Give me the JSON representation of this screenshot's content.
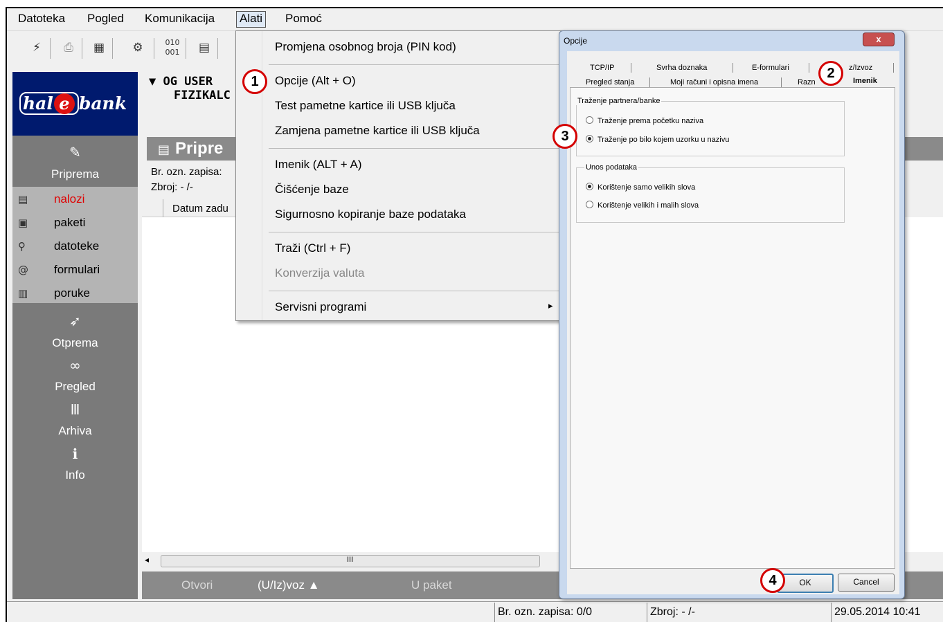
{
  "menubar": [
    "Datoteka",
    "Pogled",
    "Komunikacija",
    "Alati",
    "Pomoć"
  ],
  "toolbar_icons": [
    "connect-icon",
    "print-icon",
    "book-icon",
    "settings-icon",
    "binary-icon",
    "document-icon"
  ],
  "sidebar": {
    "logo": {
      "hal": "hal",
      "e": "e",
      "bank": "bank"
    },
    "sections": [
      {
        "icon": "edit-icon",
        "label": "Priprema"
      },
      {
        "icon": "send-icon",
        "label": "Otprema"
      },
      {
        "icon": "binoculars-icon",
        "label": "Pregled"
      },
      {
        "icon": "archive-icon",
        "label": "Arhiva"
      },
      {
        "icon": "info-icon",
        "label": "Info"
      }
    ],
    "subitems": [
      {
        "icon": "new-order-icon",
        "label": "nalozi",
        "active": true
      },
      {
        "icon": "package-icon",
        "label": "paketi"
      },
      {
        "icon": "search-icon",
        "label": "datoteke"
      },
      {
        "icon": "form-icon",
        "label": "formulari"
      },
      {
        "icon": "message-icon",
        "label": "poruke"
      }
    ]
  },
  "main": {
    "user_line1": "▼ OG USER",
    "user_line2": "FIZIKALC",
    "title": "Pripre",
    "record_label": "Br. ozn. zapisa:",
    "sum_label": "Zbroj: - /-",
    "column_header": "Datum zadu",
    "scroll_grip": "III",
    "buttons": {
      "open": "Otvori",
      "inout": "(U/Iz)voz ▲",
      "to_package": "U paket"
    }
  },
  "dropdown": {
    "items": [
      {
        "label": "Promjena osobnog broja (PIN kod)",
        "enabled": true
      },
      {
        "label": "Opcije (Alt + O)",
        "enabled": true
      },
      {
        "label": "Test pametne kartice ili USB ključa",
        "enabled": true
      },
      {
        "label": "Zamjena pametne kartice ili USB ključa",
        "enabled": true
      },
      {
        "label": "Imenik (ALT + A)",
        "enabled": true
      },
      {
        "label": "Čišćenje baze",
        "enabled": true
      },
      {
        "label": "Sigurnosno kopiranje baze podataka",
        "enabled": true
      },
      {
        "label": "Traži (Ctrl + F)",
        "enabled": true
      },
      {
        "label": "Konverzija valuta",
        "enabled": false
      },
      {
        "label": "Servisni programi",
        "enabled": true
      }
    ],
    "submenu_arrow": "▸"
  },
  "dialog": {
    "title": "Opcije",
    "close": "x",
    "tabs_row1": [
      "TCP/IP",
      "Svrha doznaka",
      "E-formulari",
      "z/Izvoz"
    ],
    "tabs_row2": [
      "Pregled stanja",
      "Moji računi i opisna imena",
      "Razn",
      "Imenik"
    ],
    "group1": {
      "title": "Traženje partnera/banke",
      "options": [
        "Traženje prema početku naziva",
        "Traženje po bilo kojem uzorku u nazivu"
      ],
      "selected": 1
    },
    "group2": {
      "title": "Unos podataka",
      "options": [
        "Korištenje samo velikih slova",
        "Korištenje velikih i malih slova"
      ],
      "selected": 0
    },
    "ok": "OK",
    "cancel": "Cancel"
  },
  "statusbar": {
    "records": "Br. ozn. zapisa: 0/0",
    "sum": "Zbroj: - /-",
    "datetime": "29.05.2014 10:41"
  },
  "callouts": [
    "1",
    "2",
    "3",
    "4"
  ]
}
